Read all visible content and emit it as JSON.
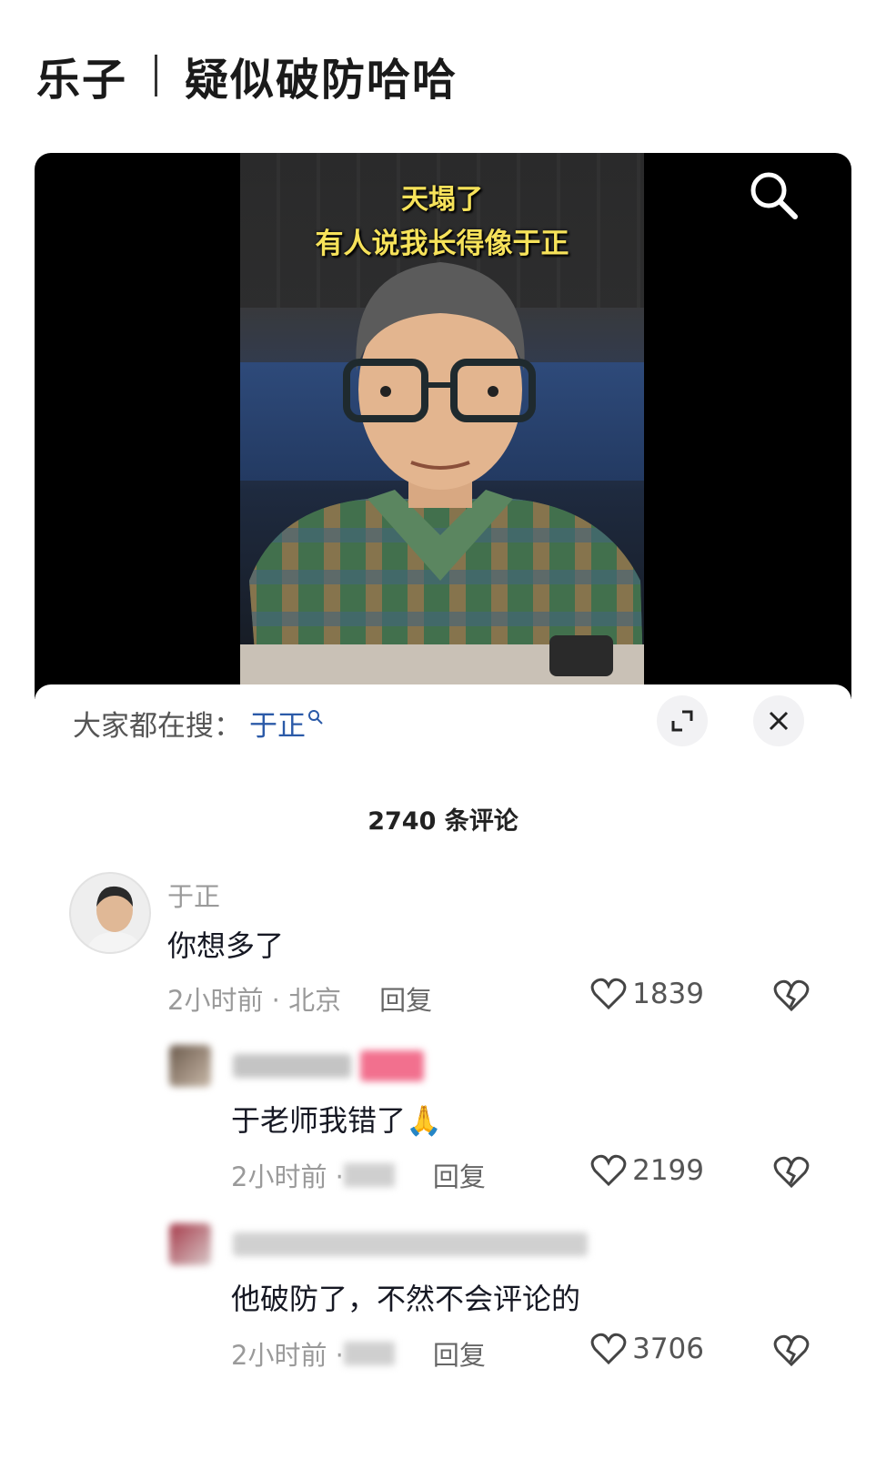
{
  "post": {
    "tag": "乐子",
    "headline": "疑似破防哈哈"
  },
  "video": {
    "caption_line1": "天塌了",
    "caption_line2": "有人说我长得像于正",
    "search_icon": "search-icon"
  },
  "hot_search": {
    "label": "大家都在搜：",
    "term": "于正",
    "expand_icon": "expand-icon",
    "close_icon": "close-icon"
  },
  "comments_header": {
    "count_text": "2740 条评论"
  },
  "comments": [
    {
      "name": "于正",
      "text": "你想多了",
      "time": "2小时前 · 北京",
      "reply": "回复",
      "likes": "1839"
    },
    {
      "name": "",
      "text": "于老师我错了🙏",
      "time": "2小时前 · ",
      "reply": "回复",
      "likes": "2199"
    },
    {
      "name": "",
      "text": "他破防了，不然不会评论的",
      "time": "2小时前 · ",
      "reply": "回复",
      "likes": "3706"
    }
  ],
  "colors": {
    "caption": "#f6e25a",
    "link": "#2b5aa8",
    "muted": "#9a9a9a"
  }
}
